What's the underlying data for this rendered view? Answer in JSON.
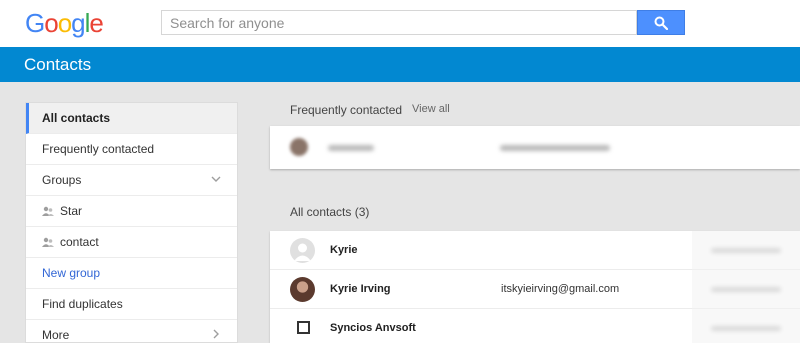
{
  "header": {
    "logo_letters": [
      {
        "ch": "G",
        "color": "#4285f4"
      },
      {
        "ch": "o",
        "color": "#ea4335"
      },
      {
        "ch": "o",
        "color": "#fbbc05"
      },
      {
        "ch": "g",
        "color": "#4285f4"
      },
      {
        "ch": "l",
        "color": "#34a853"
      },
      {
        "ch": "e",
        "color": "#ea4335"
      }
    ],
    "search_placeholder": "Search for anyone",
    "search_button_icon": "search-icon"
  },
  "app_bar": {
    "title": "Contacts",
    "color": "#0288d1"
  },
  "sidebar": {
    "items": [
      {
        "label": "All contacts",
        "active": true
      },
      {
        "label": "Frequently contacted"
      },
      {
        "label": "Groups",
        "icon": "chevron-down-icon"
      },
      {
        "label": "Star",
        "icon": "group-icon"
      },
      {
        "label": "contact",
        "icon": "group-icon"
      },
      {
        "label": "New group",
        "link": true
      },
      {
        "label": "Find duplicates"
      },
      {
        "label": "More",
        "icon": "chevron-right-icon"
      }
    ]
  },
  "frequent": {
    "heading": "Frequently contacted",
    "view_all": "View all"
  },
  "all_contacts": {
    "heading": "All contacts (3)",
    "rows": [
      {
        "name": "Kyrie",
        "email": "",
        "avatar": "default-avatar"
      },
      {
        "name": "Kyrie Irving",
        "email": "itskyieirving@gmail.com",
        "avatar": "photo-avatar"
      },
      {
        "name": "Syncios Anvsoft",
        "email": "",
        "avatar": "checkbox"
      }
    ]
  }
}
